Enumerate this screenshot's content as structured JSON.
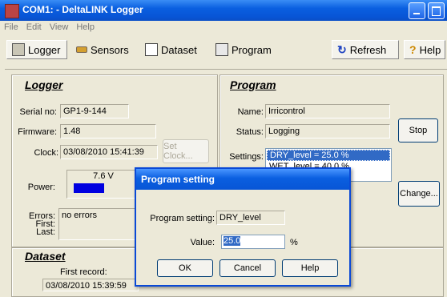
{
  "window": {
    "title": "COM1: - DeltaLINK Logger"
  },
  "menu": [
    "File",
    "Edit",
    "View",
    "Help"
  ],
  "toolbar": {
    "logger": "Logger",
    "sensors": "Sensors",
    "dataset": "Dataset",
    "program": "Program",
    "refresh": "Refresh",
    "help": "Help"
  },
  "logger": {
    "heading": "Logger",
    "serial_label": "Serial no:",
    "serial": "GP1-9-144",
    "firmware_label": "Firmware:",
    "firmware": "1.48",
    "clock_label": "Clock:",
    "clock": "03/08/2010 15:41:39",
    "set_clock": "Set Clock...",
    "power_label": "Power:",
    "power": "7.6 V",
    "power_level": 0.5,
    "errors_label": "Errors:",
    "errors": "no errors",
    "first_label": "First:",
    "last_label": "Last:"
  },
  "program": {
    "heading": "Program",
    "name_label": "Name:",
    "name": "Irricontrol",
    "status_label": "Status:",
    "status": "Logging",
    "stop": "Stop",
    "settings_label": "Settings:",
    "settings": [
      "DRY_level = 25.0 %",
      "WET_level = 40.0 %"
    ],
    "change": "Change..."
  },
  "dataset": {
    "heading": "Dataset",
    "first_record_label": "First record:",
    "first_record": "03/08/2010 15:39:59"
  },
  "dialog": {
    "title": "Program setting",
    "setting_label": "Program setting:",
    "setting": "DRY_level",
    "value_label": "Value:",
    "value": "25.0",
    "unit": "%",
    "ok": "OK",
    "cancel": "Cancel",
    "help": "Help"
  },
  "colors": {
    "title_blue": "#0a5fe0",
    "power_bar": "#0000e0",
    "selection": "#316ac5"
  }
}
